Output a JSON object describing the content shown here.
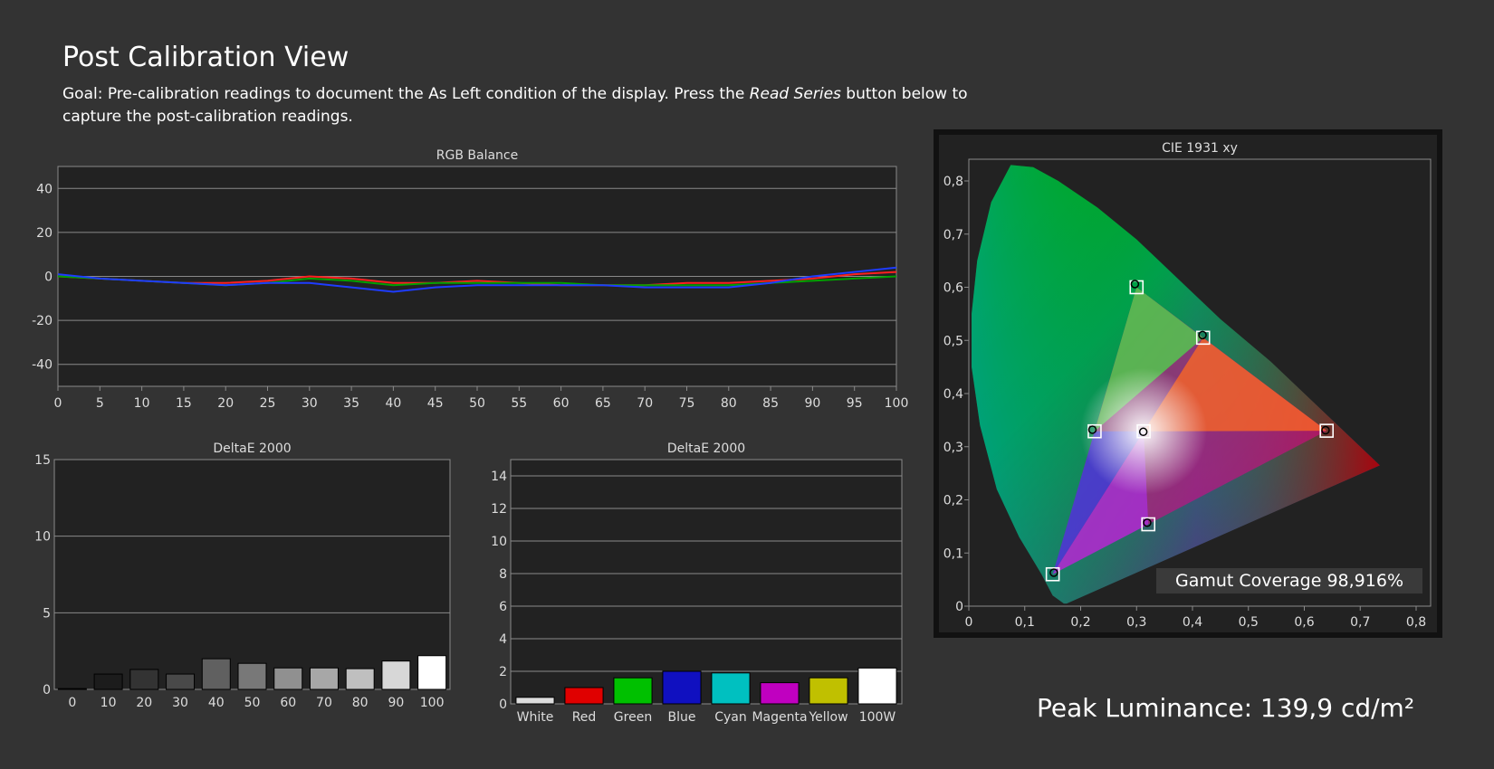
{
  "page": {
    "title": "Post Calibration View",
    "goal_before": "Goal: Pre-calibration readings to document the As Left condition of the display. Press the ",
    "goal_emph": "Read Series",
    "goal_after": " button below to capture the post-calibration readings.",
    "peak_luminance": "Peak Luminance: 139,9 cd/m²"
  },
  "chart_data": [
    {
      "id": "rgb",
      "type": "line",
      "title": "RGB Balance",
      "x": [
        0,
        5,
        10,
        15,
        20,
        25,
        30,
        35,
        40,
        45,
        50,
        55,
        60,
        65,
        70,
        75,
        80,
        85,
        90,
        95,
        100
      ],
      "xlim": [
        0,
        100
      ],
      "ylim": [
        -50,
        50
      ],
      "yticks": [
        40,
        20,
        0,
        -20,
        -40
      ],
      "grid": true,
      "series": [
        {
          "color": "#ff2020",
          "values": [
            0,
            -1,
            -2,
            -3,
            -3,
            -2,
            0,
            -1,
            -3,
            -3,
            -2,
            -3,
            -4,
            -4,
            -4,
            -3,
            -3,
            -2,
            -1,
            1,
            2
          ]
        },
        {
          "color": "#00a000",
          "values": [
            0,
            -1,
            -2,
            -3,
            -4,
            -3,
            -1,
            -2,
            -4,
            -3,
            -3,
            -3,
            -3,
            -4,
            -4,
            -4,
            -4,
            -3,
            -2,
            -1,
            0
          ]
        },
        {
          "color": "#1e3cff",
          "values": [
            1,
            -1,
            -2,
            -3,
            -4,
            -3,
            -3,
            -5,
            -7,
            -5,
            -4,
            -4,
            -4,
            -4,
            -5,
            -5,
            -5,
            -3,
            0,
            2,
            4
          ]
        }
      ]
    },
    {
      "id": "de_gray",
      "type": "bar",
      "title": "DeltaE 2000",
      "categories": [
        "0",
        "10",
        "20",
        "30",
        "40",
        "50",
        "60",
        "70",
        "80",
        "90",
        "100"
      ],
      "values": [
        0.05,
        1.0,
        1.3,
        1.0,
        2.0,
        1.7,
        1.4,
        1.4,
        1.35,
        1.85,
        2.2
      ],
      "colors": [
        "#111111",
        "#1c1c1c",
        "#333333",
        "#494949",
        "#606060",
        "#787878",
        "#909090",
        "#a7a7a7",
        "#bfbfbf",
        "#d7d7d7",
        "#ffffff"
      ],
      "ylim": [
        0,
        15
      ],
      "yticks": [
        15,
        10,
        5,
        0
      ]
    },
    {
      "id": "de_color",
      "type": "bar",
      "title": "DeltaE 2000",
      "categories": [
        "White",
        "Red",
        "Green",
        "Blue",
        "Cyan",
        "Magenta",
        "Yellow",
        "100W"
      ],
      "values": [
        0.4,
        1.0,
        1.6,
        2.0,
        1.9,
        1.3,
        1.6,
        2.2
      ],
      "colors": [
        "#dddddd",
        "#e00000",
        "#00c000",
        "#1010c0",
        "#00c0c0",
        "#c000c0",
        "#c0c000",
        "#ffffff"
      ],
      "ylim": [
        0,
        15
      ],
      "yticks": [
        14,
        12,
        10,
        8,
        6,
        4,
        2,
        0
      ]
    },
    {
      "id": "cie",
      "type": "scatter",
      "title": "CIE 1931 xy",
      "xlim": [
        0,
        0.8
      ],
      "ylim": [
        0,
        0.8
      ],
      "xticks": [
        "0",
        "0,1",
        "0,2",
        "0,3",
        "0,4",
        "0,5",
        "0,6",
        "0,7",
        "0,8"
      ],
      "yticks": [
        "0",
        "0,1",
        "0,2",
        "0,3",
        "0,4",
        "0,5",
        "0,6",
        "0,7",
        "0,8"
      ],
      "targets": [
        [
          0.64,
          0.33
        ],
        [
          0.3,
          0.6
        ],
        [
          0.15,
          0.06
        ],
        [
          0.225,
          0.329
        ],
        [
          0.321,
          0.154
        ],
        [
          0.419,
          0.505
        ],
        [
          0.3127,
          0.329
        ]
      ],
      "measured": [
        [
          0.638,
          0.331
        ],
        [
          0.297,
          0.606
        ],
        [
          0.152,
          0.063
        ],
        [
          0.221,
          0.332
        ],
        [
          0.319,
          0.157
        ],
        [
          0.418,
          0.51
        ],
        [
          0.312,
          0.328
        ]
      ],
      "gamut_coverage": "Gamut Coverage 98,916%"
    }
  ]
}
